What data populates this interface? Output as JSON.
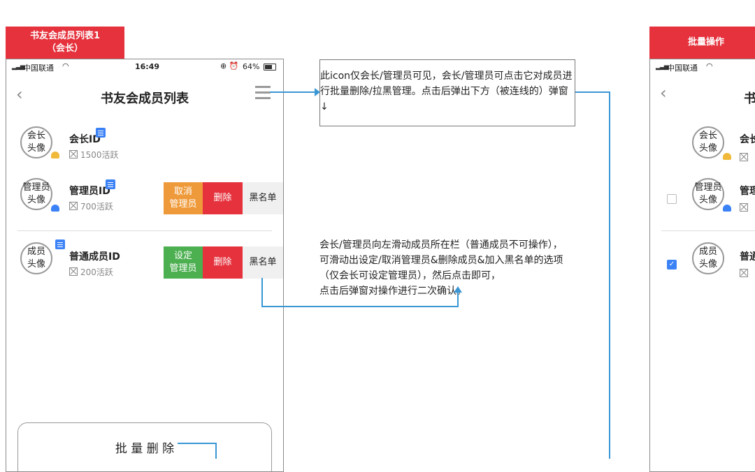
{
  "left_screen": {
    "tag_line1": "书友会成员列表1",
    "tag_line2": "（会长）",
    "status": {
      "carrier": "中国联通",
      "time": "16:49",
      "battery": "64%"
    },
    "nav": {
      "title": "书友会成员列表"
    },
    "members": [
      {
        "avatar_l1": "会长",
        "avatar_l2": "头像",
        "name": "会长ID",
        "active": "1500活跃"
      },
      {
        "avatar_l1": "管理员",
        "avatar_l2": "头像",
        "name": "管理员ID",
        "active": "700活跃",
        "actions": {
          "first_l1": "取消",
          "first_l2": "管理员",
          "delete": "删除",
          "blacklist": "黑名单"
        }
      },
      {
        "avatar_l1": "成员",
        "avatar_l2": "头像",
        "name": "普通成员ID",
        "active": "200活跃",
        "actions": {
          "first_l1": "设定",
          "first_l2": "管理员",
          "delete": "删除",
          "blacklist": "黑名单"
        }
      }
    ],
    "batch_delete": "批 量 删 除"
  },
  "annotations": {
    "menu_icon_note": "此icon仅会长/管理员可见，会长/管理员可点击它对成员进行批量删除/拉黑管理。点击后弹出下方（被连线的）弹窗↓",
    "swipe_note_l1": "会长/管理员向左滑动成员所在栏（普通成员不可操作），",
    "swipe_note_l2": "可滑动出设定/取消管理员&删除成员&加入黑名单的选项",
    "swipe_note_l3": "（仅会长可设定管理员），然后点击即可，",
    "swipe_note_l4": "点击后弹窗对操作进行二次确认。"
  },
  "right_screen": {
    "tag": "批量操作",
    "status": {
      "carrier": "中国联通"
    },
    "nav": {
      "title_partial": "书"
    },
    "members": [
      {
        "avatar_l1": "会长",
        "avatar_l2": "头像",
        "name_partial": "会长"
      },
      {
        "avatar_l1": "管理员",
        "avatar_l2": "头像",
        "name_partial": "管理",
        "checked": false
      },
      {
        "avatar_l1": "成员",
        "avatar_l2": "头像",
        "name_partial": "普通",
        "checked": true
      }
    ]
  },
  "colors": {
    "tag_red": "#e5323d",
    "orange": "#ef9a3a",
    "green": "#4caf50",
    "delete_red": "#e5323d",
    "line_blue": "#3a97d4"
  },
  "icons": [
    "back-chevron-icon",
    "menu-icon",
    "note-icon",
    "crown-badge-icon",
    "user-badge-icon",
    "wifi-icon",
    "battery-icon"
  ]
}
